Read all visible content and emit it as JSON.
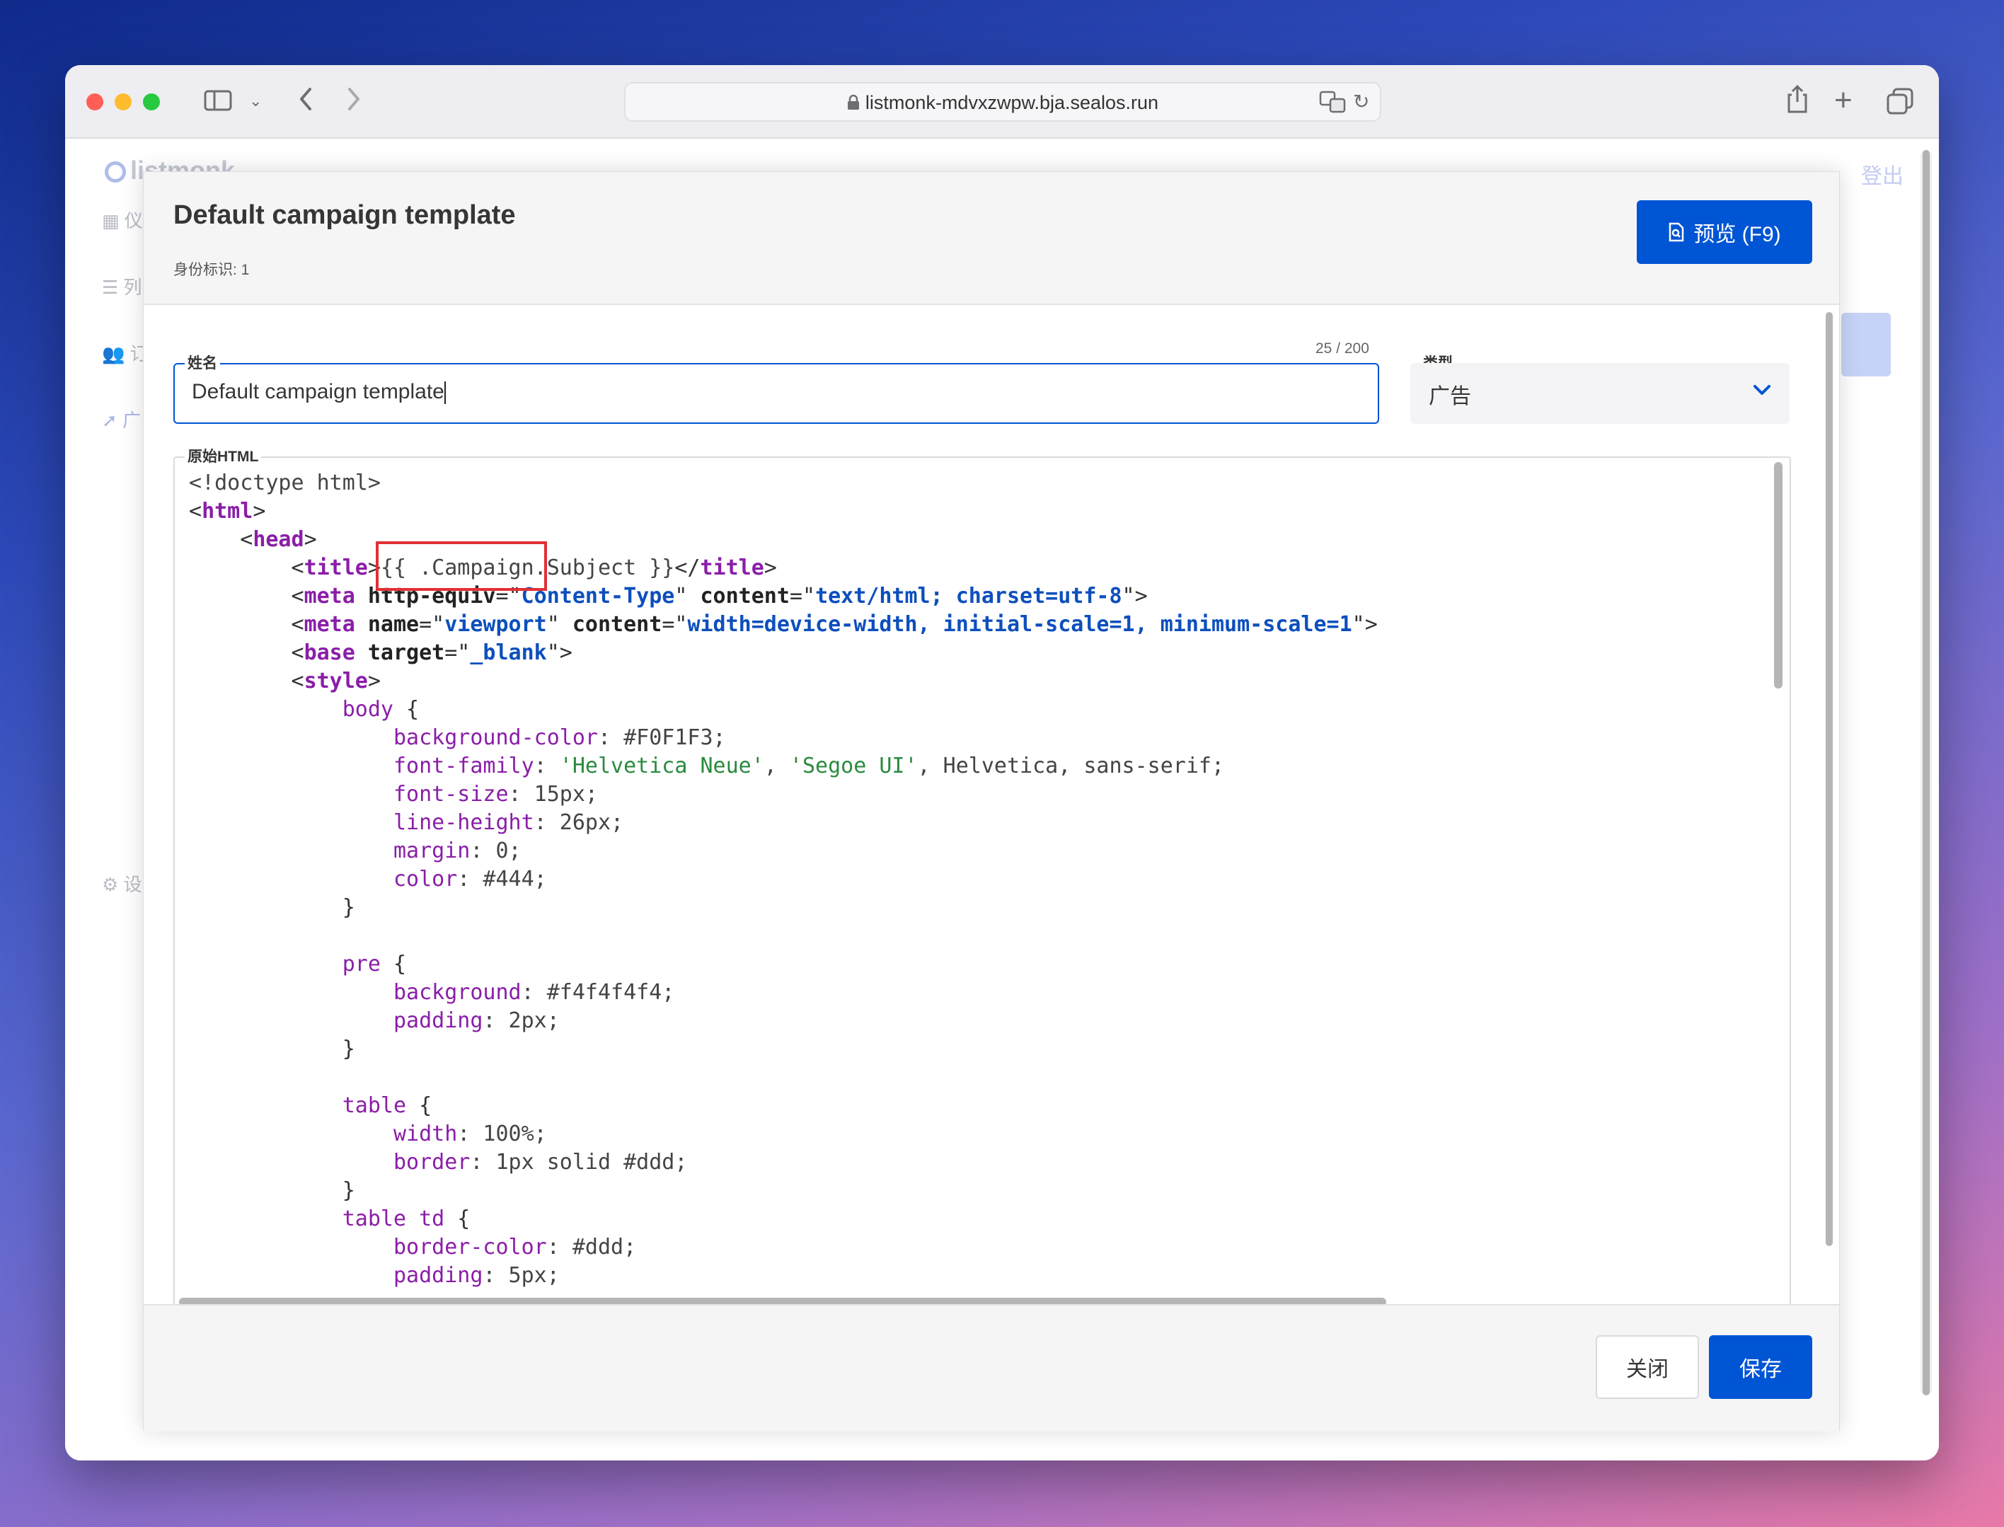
{
  "browser": {
    "url": "listmonk-mdvxzwpw.bja.sealos.run"
  },
  "app": {
    "logo_text": "listmonk",
    "logout_label": "登出",
    "sidebar_fragments": [
      "仪",
      "列",
      "订",
      "广",
      "设"
    ]
  },
  "modal": {
    "title": "Default campaign template",
    "subtitle": "身份标识: 1",
    "preview_label": "预览 (F9)",
    "name_field": {
      "label": "姓名",
      "value": "Default campaign template",
      "counter": "25 / 200"
    },
    "type_field": {
      "label": "类型",
      "value": "广告"
    },
    "code_field": {
      "label": "原始HTML"
    },
    "close_label": "关闭",
    "save_label": "保存"
  },
  "code_lines": [
    [
      {
        "t": "<!doctype html>",
        "c": "c-plain"
      }
    ],
    [
      {
        "t": "<",
        "c": "c-br"
      },
      {
        "t": "html",
        "c": "c-tag"
      },
      {
        "t": ">",
        "c": "c-br"
      }
    ],
    [
      {
        "t": "    <",
        "c": "c-br"
      },
      {
        "t": "head",
        "c": "c-tag"
      },
      {
        "t": ">",
        "c": "c-br"
      }
    ],
    [
      {
        "t": "        <",
        "c": "c-br"
      },
      {
        "t": "title",
        "c": "c-tag"
      },
      {
        "t": ">",
        "c": "c-br"
      },
      {
        "t": "{{ .Campaign.Subject }}",
        "c": "c-plain"
      },
      {
        "t": "</",
        "c": "c-br"
      },
      {
        "t": "title",
        "c": "c-tag"
      },
      {
        "t": ">",
        "c": "c-br"
      }
    ],
    [
      {
        "t": "        <",
        "c": "c-br"
      },
      {
        "t": "meta",
        "c": "c-tag"
      },
      {
        "t": " http-equiv",
        "c": "c-attr"
      },
      {
        "t": "=\"",
        "c": "c-br"
      },
      {
        "t": "Content-Type",
        "c": "c-str"
      },
      {
        "t": "\"",
        "c": "c-br"
      },
      {
        "t": " content",
        "c": "c-attr"
      },
      {
        "t": "=\"",
        "c": "c-br"
      },
      {
        "t": "text/html; charset=utf-8",
        "c": "c-str"
      },
      {
        "t": "\">",
        "c": "c-br"
      }
    ],
    [
      {
        "t": "        <",
        "c": "c-br"
      },
      {
        "t": "meta",
        "c": "c-tag"
      },
      {
        "t": " name",
        "c": "c-attr"
      },
      {
        "t": "=\"",
        "c": "c-br"
      },
      {
        "t": "viewport",
        "c": "c-str"
      },
      {
        "t": "\"",
        "c": "c-br"
      },
      {
        "t": " content",
        "c": "c-attr"
      },
      {
        "t": "=\"",
        "c": "c-br"
      },
      {
        "t": "width=device-width, initial-scale=1, minimum-scale=1",
        "c": "c-str"
      },
      {
        "t": "\">",
        "c": "c-br"
      }
    ],
    [
      {
        "t": "        <",
        "c": "c-br"
      },
      {
        "t": "base",
        "c": "c-tag"
      },
      {
        "t": " target",
        "c": "c-attr"
      },
      {
        "t": "=\"",
        "c": "c-br"
      },
      {
        "t": "_blank",
        "c": "c-str"
      },
      {
        "t": "\">",
        "c": "c-br"
      }
    ],
    [
      {
        "t": "        <",
        "c": "c-br"
      },
      {
        "t": "style",
        "c": "c-tag"
      },
      {
        "t": ">",
        "c": "c-br"
      }
    ],
    [
      {
        "t": "            body",
        "c": "c-sel"
      },
      {
        "t": " {",
        "c": "c-br"
      }
    ],
    [
      {
        "t": "                background-color",
        "c": "c-prop"
      },
      {
        "t": ": #F0F1F3;",
        "c": "c-plain"
      }
    ],
    [
      {
        "t": "                font-family",
        "c": "c-prop"
      },
      {
        "t": ": ",
        "c": "c-plain"
      },
      {
        "t": "'Helvetica Neue'",
        "c": "c-sstr"
      },
      {
        "t": ", ",
        "c": "c-plain"
      },
      {
        "t": "'Segoe UI'",
        "c": "c-sstr"
      },
      {
        "t": ", Helvetica, sans-serif;",
        "c": "c-plain"
      }
    ],
    [
      {
        "t": "                font-size",
        "c": "c-prop"
      },
      {
        "t": ": 15px;",
        "c": "c-plain"
      }
    ],
    [
      {
        "t": "                line-height",
        "c": "c-prop"
      },
      {
        "t": ": 26px;",
        "c": "c-plain"
      }
    ],
    [
      {
        "t": "                margin",
        "c": "c-prop"
      },
      {
        "t": ": 0;",
        "c": "c-plain"
      }
    ],
    [
      {
        "t": "                color",
        "c": "c-prop"
      },
      {
        "t": ": #444;",
        "c": "c-plain"
      }
    ],
    [
      {
        "t": "            }",
        "c": "c-br"
      }
    ],
    [
      {
        "t": "",
        "c": "c-plain"
      }
    ],
    [
      {
        "t": "            pre",
        "c": "c-sel"
      },
      {
        "t": " {",
        "c": "c-br"
      }
    ],
    [
      {
        "t": "                background",
        "c": "c-prop"
      },
      {
        "t": ": #f4f4f4f4;",
        "c": "c-plain"
      }
    ],
    [
      {
        "t": "                padding",
        "c": "c-prop"
      },
      {
        "t": ": 2px;",
        "c": "c-plain"
      }
    ],
    [
      {
        "t": "            }",
        "c": "c-br"
      }
    ],
    [
      {
        "t": "",
        "c": "c-plain"
      }
    ],
    [
      {
        "t": "            table",
        "c": "c-sel"
      },
      {
        "t": " {",
        "c": "c-br"
      }
    ],
    [
      {
        "t": "                width",
        "c": "c-prop"
      },
      {
        "t": ": 100%;",
        "c": "c-plain"
      }
    ],
    [
      {
        "t": "                border",
        "c": "c-prop"
      },
      {
        "t": ": 1px solid #ddd;",
        "c": "c-plain"
      }
    ],
    [
      {
        "t": "            }",
        "c": "c-br"
      }
    ],
    [
      {
        "t": "            table td",
        "c": "c-sel"
      },
      {
        "t": " {",
        "c": "c-br"
      }
    ],
    [
      {
        "t": "                border-color",
        "c": "c-prop"
      },
      {
        "t": ": #ddd;",
        "c": "c-plain"
      }
    ],
    [
      {
        "t": "                padding",
        "c": "c-prop"
      },
      {
        "t": ": 5px;",
        "c": "c-plain"
      }
    ],
    [
      {
        "t": "            }",
        "c": "c-br"
      }
    ]
  ],
  "colors": {
    "primary": "#0055d4",
    "highlight_box": "#e03036"
  }
}
